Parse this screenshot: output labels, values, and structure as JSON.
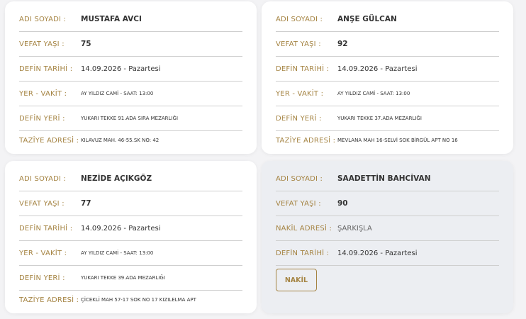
{
  "cards": [
    {
      "rows": [
        {
          "label": "ADI SOYADI :",
          "value": "MUSTAFA AVCI"
        },
        {
          "label": "VEFAT YAŞI :",
          "value": "75"
        },
        {
          "label": "DEFİN TARİHİ :",
          "value": "14.09.2026 - Pazartesi"
        },
        {
          "label": "YER - VAKİT :",
          "value": "AY YILDIZ CAMİ - SAAT: 13:00"
        },
        {
          "label": "DEFİN YERİ :",
          "value": "YUKARI TEKKE 91.ADA SIRA MEZARLIĞI"
        },
        {
          "label": "TAZİYE ADRESİ :",
          "value": "KILAVUZ MAH. 46-55.SK NO: 42"
        }
      ]
    },
    {
      "rows": [
        {
          "label": "ADI SOYADI :",
          "value": "ANŞE GÜLCAN"
        },
        {
          "label": "VEFAT YAŞI :",
          "value": "92"
        },
        {
          "label": "DEFİN TARİHİ :",
          "value": "14.09.2026 - Pazartesi"
        },
        {
          "label": "YER - VAKİT :",
          "value": "AY YILDIZ CAMİ - SAAT: 13:00"
        },
        {
          "label": "DEFİN YERİ :",
          "value": "YUKARI TEKKE 37.ADA MEZARLIĞI"
        },
        {
          "label": "TAZİYE ADRESİ :",
          "value": "MEVLANA MAH 16-SELVİ SOK BİRGÜL APT NO 16"
        }
      ]
    },
    {
      "rows": [
        {
          "label": "ADI SOYADI :",
          "value": "NEZİDE AÇIKGÖZ"
        },
        {
          "label": "VEFAT YAŞI :",
          "value": "77"
        },
        {
          "label": "DEFİN TARİHİ :",
          "value": "14.09.2026 - Pazartesi"
        },
        {
          "label": "YER - VAKİT :",
          "value": "AY YILDIZ CAMİ - SAAT: 13:00"
        },
        {
          "label": "DEFİN YERİ :",
          "value": "YUKARI TEKKE 39.ADA MEZARLIĞI"
        },
        {
          "label": "TAZİYE ADRESİ :",
          "value": "ÇİCEKLİ MAH 57-17 SOK NO 17 KIZILELMA APT"
        }
      ]
    },
    {
      "rows": [
        {
          "label": "ADI SOYADI :",
          "value": "SAADETTİN BAHCİVAN"
        },
        {
          "label": "VEFAT YAŞI :",
          "value": "90"
        },
        {
          "label": "NAKİL ADRESİ :",
          "value": "ŞARKIŞLA"
        },
        {
          "label": "DEFİN TARİHİ :",
          "value": "14.09.2026 - Pazartesi"
        }
      ],
      "button_label": "NAKİL"
    }
  ],
  "colors": {
    "label": "#a58443",
    "card_bg": "#ffffff",
    "card_alt_bg": "#eceef2",
    "page_bg": "#f3f3f5"
  }
}
